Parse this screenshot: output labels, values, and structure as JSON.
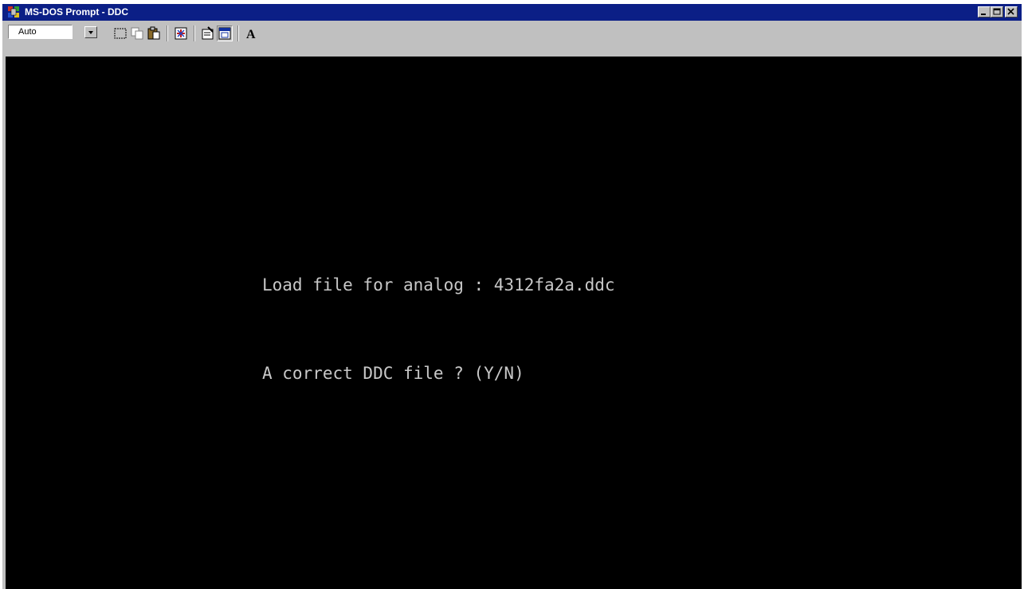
{
  "window": {
    "title": "MS-DOS Prompt - DDC"
  },
  "titlebar": {
    "app_icon": "msdos-icon",
    "controls": [
      "minimize-icon",
      "maximize-icon",
      "close-icon"
    ]
  },
  "toolbar": {
    "font_size": "Auto",
    "buttons": [
      "mark-icon",
      "copy-icon",
      "paste-icon",
      "fullscreen-icon",
      "properties-icon",
      "background-icon",
      "font-icon"
    ]
  },
  "console": {
    "lines": [
      "Load file for analog : 4312fa2a.ddc",
      "A correct DDC file ? (Y/N)"
    ]
  },
  "colors": {
    "titlebar": "#0b1f86",
    "console_bg": "#000000",
    "console_text": "#c8c8c8",
    "chrome": "#c0c0c0"
  }
}
